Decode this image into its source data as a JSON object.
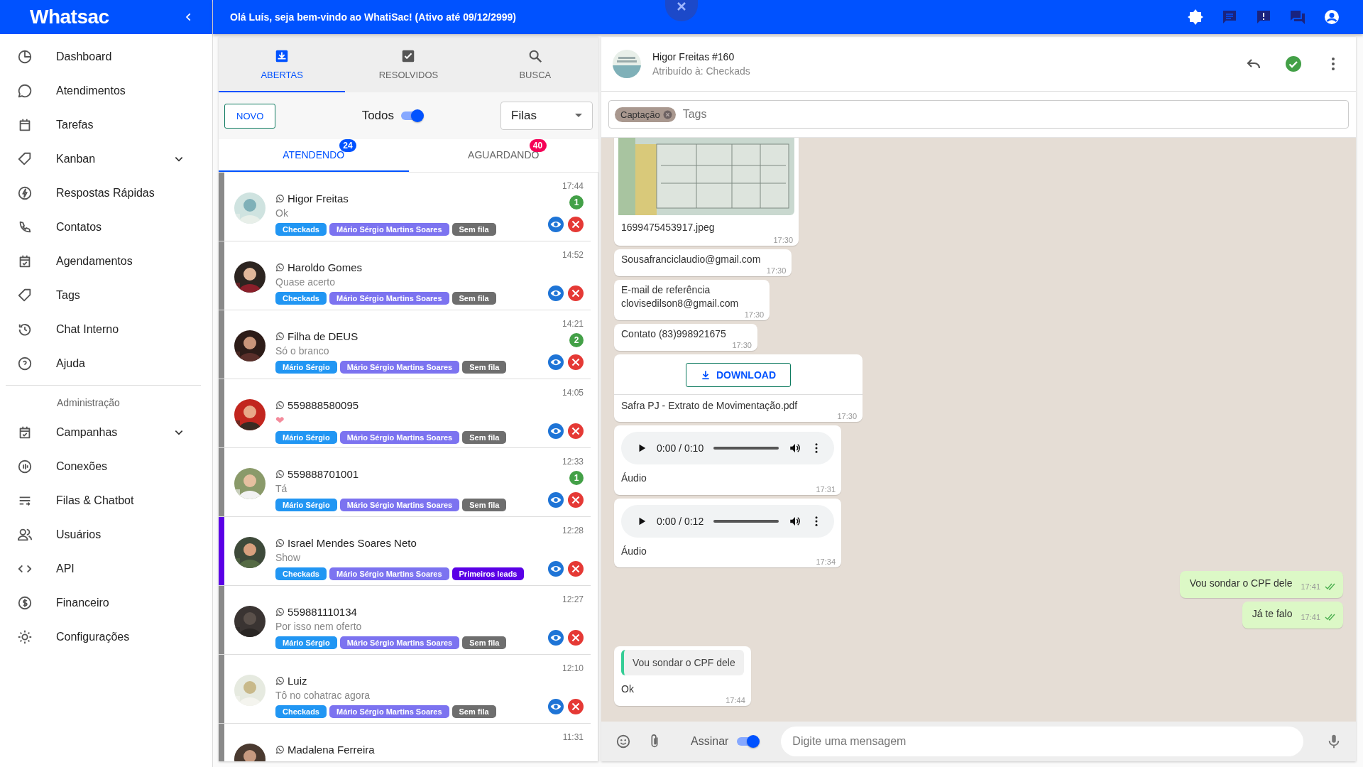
{
  "topbar": {
    "logo": "Whatsac",
    "welcome": "Olá Luís, seja bem-vindo ao WhatiSac! (Ativo até 09/12/2999)"
  },
  "sidebar": {
    "items": [
      {
        "kind": "link",
        "label": "Dashboard"
      },
      {
        "kind": "link",
        "label": "Atendimentos"
      },
      {
        "kind": "link",
        "label": "Tarefas"
      },
      {
        "kind": "group",
        "label": "Kanban"
      },
      {
        "kind": "link",
        "label": "Respostas Rápidas"
      },
      {
        "kind": "link",
        "label": "Contatos"
      },
      {
        "kind": "link",
        "label": "Agendamentos"
      },
      {
        "kind": "link",
        "label": "Tags"
      },
      {
        "kind": "link",
        "label": "Chat Interno"
      },
      {
        "kind": "link",
        "label": "Ajuda"
      },
      {
        "kind": "header",
        "label": "Administração"
      },
      {
        "kind": "group",
        "label": "Campanhas"
      },
      {
        "kind": "link",
        "label": "Conexões"
      },
      {
        "kind": "link",
        "label": "Filas & Chatbot"
      },
      {
        "kind": "link",
        "label": "Usuários"
      },
      {
        "kind": "link",
        "label": "API"
      },
      {
        "kind": "link",
        "label": "Financeiro"
      },
      {
        "kind": "link",
        "label": "Configurações"
      }
    ]
  },
  "tickets": {
    "tabs": [
      {
        "label": "ABERTAS",
        "selected": true
      },
      {
        "label": "RESOLVIDOS",
        "selected": false
      },
      {
        "label": "BUSCA",
        "selected": false
      }
    ],
    "new_button": "NOVO",
    "todos": {
      "label": "Todos",
      "on": true
    },
    "queue_select": "Filas",
    "subtabs": [
      {
        "label": "ATENDENDO",
        "badge": "24",
        "selected": true
      },
      {
        "label": "AGUARDANDO",
        "badge": "40",
        "selected": false
      }
    ],
    "rows": [
      {
        "name": "Higor Freitas",
        "message": "Ok",
        "time": "17:44",
        "unread": "1",
        "color": "#8a8a8a",
        "tags": [
          {
            "label": "Checkads",
            "color": "#2196f3"
          },
          {
            "label": "Mário Sérgio Martins Soares",
            "color": "#7c73f0"
          },
          {
            "label": "Sem fila",
            "color": "#6e6e6e"
          }
        ]
      },
      {
        "name": "Haroldo Gomes",
        "message": "Quase acerto",
        "time": "14:52",
        "color": "#8a8a8a",
        "tags": [
          {
            "label": "Checkads",
            "color": "#2196f3"
          },
          {
            "label": "Mário Sérgio Martins Soares",
            "color": "#7c73f0"
          },
          {
            "label": "Sem fila",
            "color": "#6e6e6e"
          }
        ]
      },
      {
        "name": "Filha de DEUS",
        "message": "Só o branco",
        "time": "14:21",
        "unread": "2",
        "color": "#8a8a8a",
        "tags": [
          {
            "label": "Mário Sérgio",
            "color": "#2196f3"
          },
          {
            "label": "Mário Sérgio Martins Soares",
            "color": "#7c73f0"
          },
          {
            "label": "Sem fila",
            "color": "#6e6e6e"
          }
        ]
      },
      {
        "name": "559888580095",
        "message": "❤",
        "time": "14:05",
        "color": "#8a8a8a",
        "tags": [
          {
            "label": "Mário Sérgio",
            "color": "#2196f3"
          },
          {
            "label": "Mário Sérgio Martins Soares",
            "color": "#7c73f0"
          },
          {
            "label": "Sem fila",
            "color": "#6e6e6e"
          }
        ]
      },
      {
        "name": "559888701001",
        "message": "Tá",
        "time": "12:33",
        "unread": "1",
        "color": "#8a8a8a",
        "tags": [
          {
            "label": "Mário Sérgio",
            "color": "#2196f3"
          },
          {
            "label": "Mário Sérgio Martins Soares",
            "color": "#7c73f0"
          },
          {
            "label": "Sem fila",
            "color": "#6e6e6e"
          }
        ]
      },
      {
        "name": "Israel Mendes Soares Neto",
        "message": "Show",
        "time": "12:28",
        "color": "#5a00e6",
        "tags": [
          {
            "label": "Checkads",
            "color": "#2196f3"
          },
          {
            "label": "Mário Sérgio Martins Soares",
            "color": "#7c73f0"
          },
          {
            "label": "Primeiros leads",
            "color": "#5a00e6"
          }
        ]
      },
      {
        "name": "559881110134",
        "message": "Por isso nem oferto",
        "time": "12:27",
        "color": "#8a8a8a",
        "tags": [
          {
            "label": "Mário Sérgio",
            "color": "#2196f3"
          },
          {
            "label": "Mário Sérgio Martins Soares",
            "color": "#7c73f0"
          },
          {
            "label": "Sem fila",
            "color": "#6e6e6e"
          }
        ]
      },
      {
        "name": "Luiz",
        "message": "Tô no cohatrac agora",
        "time": "12:10",
        "color": "#8a8a8a",
        "tags": [
          {
            "label": "Checkads",
            "color": "#2196f3"
          },
          {
            "label": "Mário Sérgio Martins Soares",
            "color": "#7c73f0"
          },
          {
            "label": "Sem fila",
            "color": "#6e6e6e"
          }
        ]
      },
      {
        "name": "Madalena Ferreira",
        "time": "11:31",
        "color": "#8a8a8a"
      }
    ]
  },
  "chat": {
    "contact": "Higor Freitas #160",
    "assigned": "Atribuído à: Checkads",
    "tag_chips": [
      "Captação"
    ],
    "tags_placeholder": "Tags",
    "messages": [
      {
        "caption": "1699475453917.jpeg",
        "time": "17:30"
      },
      {
        "kind": "text",
        "text": "Sousafranciclaudio@gmail.com",
        "time": "17:30"
      },
      {
        "kind": "text",
        "text": "E-mail de referência\nclovisedilson8@gmail.com",
        "time": "17:30"
      },
      {
        "kind": "text",
        "text": "Contato (83)998921675",
        "time": "17:30"
      },
      {
        "kind": "document",
        "button": "DOWNLOAD",
        "text": "Safra PJ - Extrato de Movimentação.pdf",
        "time": "17:30"
      },
      {
        "kind": "audio",
        "player_time": "0:00 / 0:10",
        "text": "Áudio",
        "time": "17:31"
      },
      {
        "kind": "audio",
        "player_time": "0:00 / 0:12",
        "text": "Áudio",
        "time": "17:34"
      },
      {
        "kind": "outgoing",
        "text": "Vou sondar o CPF dele",
        "time": "17:41"
      },
      {
        "kind": "outgoing",
        "text": "Já te falo",
        "time": "17:41"
      },
      {
        "kind": "quoted",
        "quote": "Vou sondar o CPF dele",
        "text": "Ok",
        "time": "17:44"
      }
    ],
    "sign": {
      "label": "Assinar",
      "on": true
    },
    "input_placeholder": "Digite uma mensagem"
  }
}
